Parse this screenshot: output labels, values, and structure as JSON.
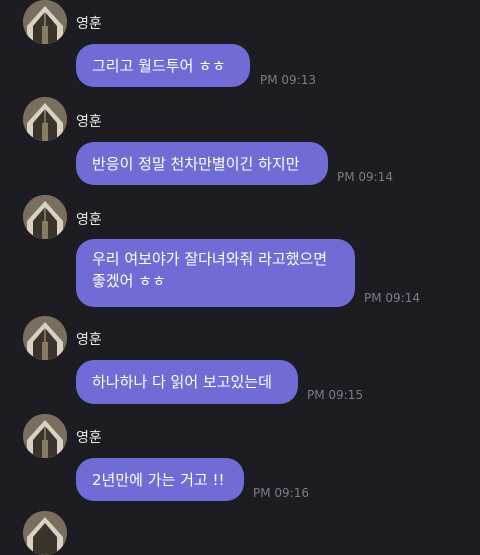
{
  "messages": [
    {
      "sender": "영훈",
      "text": "그리고 월드투어 ㅎㅎ",
      "time": "PM 09:13"
    },
    {
      "sender": "영훈",
      "text": "반응이 정말 천차만별이긴 하지만",
      "time": "PM 09:14"
    },
    {
      "sender": "영훈",
      "text": "우리 여보야가 잘다녀와줘 라고했으면 좋겠어 ㅎㅎ",
      "time": "PM 09:14"
    },
    {
      "sender": "영훈",
      "text": "하나하나 다 읽어 보고있는데",
      "time": "PM 09:15"
    },
    {
      "sender": "영훈",
      "text": "2년만에 가는 거고 !!",
      "time": "PM 09:16"
    }
  ],
  "colors": {
    "background": "#1c1c22",
    "bubble": "#6f6cd6",
    "bubble_text": "#ffffff",
    "sender_text": "#e6e6ea",
    "time_text": "#7c7c86"
  },
  "icons": {
    "avatar": "profile-photo-icon"
  }
}
